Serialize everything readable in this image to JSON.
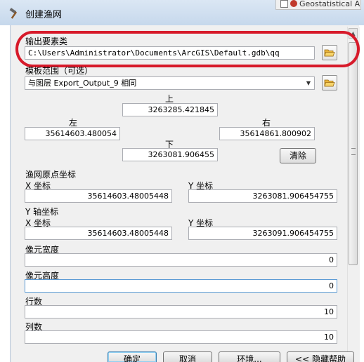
{
  "window": {
    "title": "创建渔网",
    "background_window_text": "Geostatistical A"
  },
  "output": {
    "label": "输出要素类",
    "value": "C:\\Users\\Administrator\\Documents\\ArcGIS\\Default.gdb\\qq"
  },
  "extent": {
    "label": "模板范围（可选）",
    "dropdown_value": "与图层 Export_Output_9 相同",
    "top_label": "上",
    "top_value": "3263285.421845",
    "left_label": "左",
    "left_value": "35614603.480054",
    "right_label": "右",
    "right_value": "35614861.800902",
    "bottom_label": "下",
    "bottom_value": "3263081.906455",
    "clear_button": "清除"
  },
  "origin": {
    "label": "渔网原点坐标",
    "x_label": "X 坐标",
    "x_value": "35614603.48005448",
    "y_label": "Y 坐标",
    "y_value": "3263081.906454755"
  },
  "yaxis": {
    "label": "Y 轴坐标",
    "x_label": "X 坐标",
    "x_value": "35614603.48005448",
    "y_label": "Y 坐标",
    "y_value": "3263091.906454755"
  },
  "cell_width": {
    "label": "像元宽度",
    "value": "0"
  },
  "cell_height": {
    "label": "像元高度",
    "value": "0"
  },
  "rows": {
    "label": "行数",
    "value": "10"
  },
  "cols": {
    "label": "列数",
    "value": "10"
  },
  "buttons": {
    "ok": "确定",
    "cancel": "取消",
    "env": "环境...",
    "hide_help": "<< 隐藏帮助"
  },
  "colors": {
    "highlight_oval": "#d71a2a",
    "titlebar": "#c6d8ec"
  },
  "icons": {
    "title": "hammer-icon",
    "browse": "open-folder-icon"
  }
}
